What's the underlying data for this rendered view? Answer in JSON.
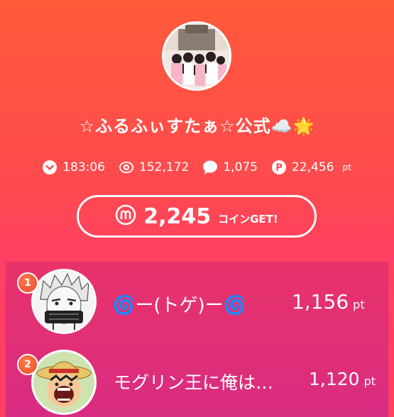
{
  "profile": {
    "title": "☆ふるふぃすたぁ☆公式☁️🌟"
  },
  "stats": {
    "time": "183:06",
    "views": "152,172",
    "comments": "1,075",
    "points": "22,456",
    "points_unit": "pt"
  },
  "coin_button": {
    "amount": "2,245",
    "suffix": "コインGET!"
  },
  "ranking": [
    {
      "rank": "1",
      "name": "🌀ー(トゲ)ー🌀",
      "points": "1,156",
      "unit": "pt"
    },
    {
      "rank": "2",
      "name": "モグリン王に俺は…",
      "points": "1,120",
      "unit": "pt"
    }
  ],
  "colors": {
    "gradient_top": "#ff5a3a",
    "gradient_bottom": "#ff3f63",
    "ranking_bg": "#e8326a",
    "badge": "#ee4a2a"
  }
}
